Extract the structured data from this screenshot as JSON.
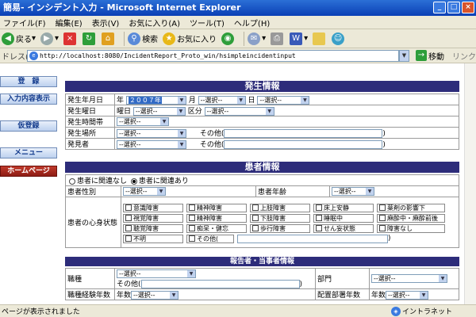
{
  "window": {
    "title": "簡易- インシデント入力 - Microsoft Internet Explorer"
  },
  "menu": [
    "ファイル(F)",
    "編集(E)",
    "表示(V)",
    "お気に入り(A)",
    "ツール(T)",
    "ヘルプ(H)"
  ],
  "toolbar": {
    "back": "戻る",
    "search": "検索",
    "favorites": "お気に入り"
  },
  "address": {
    "label": "ドレス(D)",
    "url": "http://localhost:8080/IncidentReport_Proto_win/hsimpleincidentinput",
    "go": "移動",
    "links": "リンク"
  },
  "nav": {
    "register": "登　録",
    "view": "入力内容表示",
    "temp": "仮登録",
    "menu": "メニュー",
    "home": "ホームページ"
  },
  "sections": {
    "occurrence": "発生情報",
    "patient": "患者情報",
    "reporter": "報告者・当事者情報"
  },
  "occurrence": {
    "date_label": "発生年月日",
    "year_prefix": "年",
    "year_value": "２００７年",
    "month_suffix": "月",
    "day_suffix": "日",
    "weekday_label": "発生曜日",
    "weekday_prefix": "曜日",
    "category_label": "区分",
    "time_label": "発生時間帯",
    "place_label": "発生場所",
    "other": "その他(",
    "close": ")",
    "discoverer_label": "発見者"
  },
  "select_default": "--選択--",
  "patient": {
    "related_no": "患者に関連なし",
    "related_yes": "患者に関連あり",
    "gender_label": "患者性別",
    "age_label": "患者年齢",
    "condition_label": "患者の心身状態",
    "conditions": [
      [
        "意識障害",
        "精神障害",
        "上肢障害",
        "床上安静",
        "薬剤の影響下"
      ],
      [
        "視覚障害",
        "精神障害",
        "下肢障害",
        "睡眠中",
        "麻酔中・麻酔前後"
      ],
      [
        "聴覚障害",
        "痴呆・健忘",
        "歩行障害",
        "せん妄状態",
        "障害なし"
      ],
      [
        "不明",
        "その他(",
        "",
        "",
        ""
      ]
    ]
  },
  "reporter": {
    "job_label": "職種",
    "other": "その他(",
    "close": ")",
    "dept_label": "部門",
    "exp_label": "職種経験年数",
    "years": "年数",
    "dept_years_label": "配置部署年数"
  },
  "status": {
    "text": "ページが表示されました",
    "zone": "イントラネット"
  }
}
